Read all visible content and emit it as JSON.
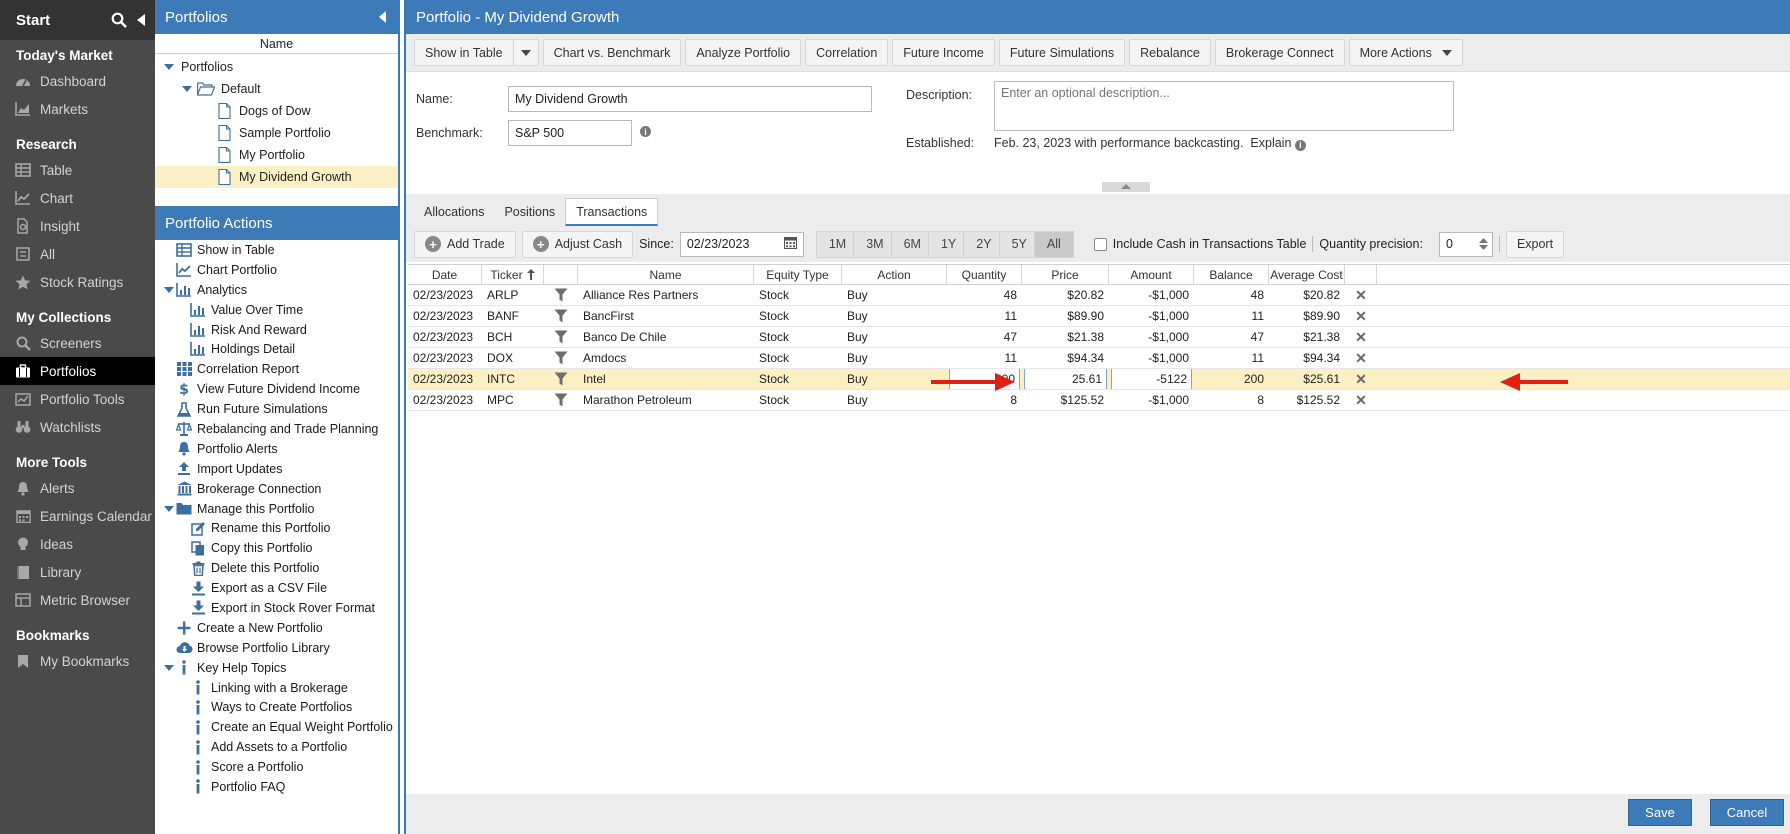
{
  "nav": {
    "start_label": "Start",
    "sections": [
      {
        "title": "Today's Market",
        "items": [
          {
            "label": "Dashboard",
            "icon": "dashboard-icon"
          },
          {
            "label": "Markets",
            "icon": "markets-icon"
          }
        ]
      },
      {
        "title": "Research",
        "items": [
          {
            "label": "Table",
            "icon": "table-icon"
          },
          {
            "label": "Chart",
            "icon": "chart-icon"
          },
          {
            "label": "Insight",
            "icon": "insight-icon"
          },
          {
            "label": "All",
            "icon": "all-icon"
          },
          {
            "label": "Stock Ratings",
            "icon": "star-icon"
          }
        ]
      },
      {
        "title": "My Collections",
        "items": [
          {
            "label": "Screeners",
            "icon": "search-icon"
          },
          {
            "label": "Portfolios",
            "icon": "briefcase-icon",
            "active": true
          },
          {
            "label": "Portfolio Tools",
            "icon": "tools-icon"
          },
          {
            "label": "Watchlists",
            "icon": "binoculars-icon"
          }
        ]
      },
      {
        "title": "More Tools",
        "items": [
          {
            "label": "Alerts",
            "icon": "bell-icon"
          },
          {
            "label": "Earnings Calendar",
            "icon": "calendar-icon"
          },
          {
            "label": "Ideas",
            "icon": "lightbulb-icon"
          },
          {
            "label": "Library",
            "icon": "library-icon"
          },
          {
            "label": "Metric Browser",
            "icon": "metric-browser-icon"
          }
        ]
      },
      {
        "title": "Bookmarks",
        "items": [
          {
            "label": "My Bookmarks",
            "icon": "bookmark-icon"
          }
        ]
      }
    ]
  },
  "tree": {
    "title": "Portfolios",
    "column_header": "Name",
    "nodes": [
      {
        "label": "Portfolios",
        "level": 0
      },
      {
        "label": "Default",
        "level": 1
      },
      {
        "label": "Dogs of Dow",
        "level": 2
      },
      {
        "label": "Sample Portfolio",
        "level": 2
      },
      {
        "label": "My Portfolio",
        "level": 2
      },
      {
        "label": "My Dividend Growth",
        "level": 2
      }
    ]
  },
  "portfolio_actions": {
    "title": "Portfolio Actions",
    "items": [
      {
        "label": "Show in Table",
        "level": 1,
        "icon": "table-icon"
      },
      {
        "label": "Chart Portfolio",
        "level": 1,
        "icon": "chart-icon"
      },
      {
        "label": "Analytics",
        "level": 0,
        "icon": "analytics-icon"
      },
      {
        "label": "Value Over Time",
        "level": 2,
        "icon": "bar-chart-icon"
      },
      {
        "label": "Risk And Reward",
        "level": 2,
        "icon": "bar-chart-icon"
      },
      {
        "label": "Holdings Detail",
        "level": 2,
        "icon": "bar-chart-icon"
      },
      {
        "label": "Correlation Report",
        "level": 1,
        "icon": "grid-icon"
      },
      {
        "label": "View Future Dividend Income",
        "level": 1,
        "icon": "dollar-icon"
      },
      {
        "label": "Run Future Simulations",
        "level": 1,
        "icon": "flask-icon"
      },
      {
        "label": "Rebalancing and Trade Planning",
        "level": 1,
        "icon": "scale-icon"
      },
      {
        "label": "Portfolio Alerts",
        "level": 1,
        "icon": "bell-icon"
      },
      {
        "label": "Import Updates",
        "level": 1,
        "icon": "upload-icon"
      },
      {
        "label": "Brokerage Connection",
        "level": 1,
        "icon": "bank-icon"
      },
      {
        "label": "Manage this Portfolio",
        "level": 0,
        "icon": "folder-icon"
      },
      {
        "label": "Rename this Portfolio",
        "level": 2,
        "icon": "edit-icon"
      },
      {
        "label": "Copy this Portfolio",
        "level": 2,
        "icon": "copy-icon"
      },
      {
        "label": "Delete this Portfolio",
        "level": 2,
        "icon": "trash-icon"
      },
      {
        "label": "Export as a CSV File",
        "level": 2,
        "icon": "download-icon"
      },
      {
        "label": "Export in Stock Rover Format",
        "level": 2,
        "icon": "download-icon"
      },
      {
        "label": "Create a New Portfolio",
        "level": 1,
        "icon": "plus-icon"
      },
      {
        "label": "Browse Portfolio Library",
        "level": 1,
        "icon": "cloud-download-icon"
      },
      {
        "label": "Key Help Topics",
        "level": 0,
        "icon": "info-icon"
      },
      {
        "label": "Linking with a Brokerage",
        "level": 2,
        "icon": "info-icon"
      },
      {
        "label": "Ways to Create Portfolios",
        "level": 2,
        "icon": "info-icon"
      },
      {
        "label": "Create an Equal Weight Portfolio",
        "level": 2,
        "icon": "info-icon"
      },
      {
        "label": "Add Assets to a Portfolio",
        "level": 2,
        "icon": "info-icon"
      },
      {
        "label": "Score a Portfolio",
        "level": 2,
        "icon": "info-icon"
      },
      {
        "label": "Portfolio FAQ",
        "level": 2,
        "icon": "info-icon"
      }
    ]
  },
  "main": {
    "title": "Portfolio - My Dividend Growth",
    "toolbar": [
      {
        "label": "Show in Table",
        "split": true
      },
      {
        "label": "Chart vs. Benchmark"
      },
      {
        "label": "Analyze Portfolio"
      },
      {
        "label": "Correlation"
      },
      {
        "label": "Future Income"
      },
      {
        "label": "Future Simulations"
      },
      {
        "label": "Rebalance"
      },
      {
        "label": "Brokerage Connect"
      },
      {
        "label": "More Actions",
        "dropdown": true
      }
    ],
    "form": {
      "name_label": "Name:",
      "name_value": "My Dividend Growth",
      "benchmark_label": "Benchmark:",
      "benchmark_value": "S&P 500",
      "description_label": "Description:",
      "description_placeholder": "Enter an optional description...",
      "established_label": "Established:",
      "established_value": "Feb. 23, 2023 with performance backcasting.",
      "explain_label": "Explain"
    },
    "tabs": [
      {
        "label": "Allocations"
      },
      {
        "label": "Positions"
      },
      {
        "label": "Transactions",
        "active": true
      }
    ],
    "tx_toolbar": {
      "add_trade": "Add Trade",
      "adjust_cash": "Adjust Cash",
      "since_label": "Since:",
      "since_value": "02/23/2023",
      "ranges": [
        "1M",
        "3M",
        "6M",
        "1Y",
        "2Y",
        "5Y",
        "All"
      ],
      "active_range": "All",
      "include_cash_label": "Include Cash in Transactions Table",
      "precision_label": "Quantity precision:",
      "precision_value": "0",
      "export_label": "Export"
    },
    "grid": {
      "columns": [
        "Date",
        "Ticker",
        "",
        "Name",
        "Equity Type",
        "Action",
        "Quantity",
        "Price",
        "Amount",
        "Balance",
        "Average Cost",
        ""
      ],
      "rows": [
        {
          "date": "02/23/2023",
          "ticker": "ARLP",
          "name": "Alliance Res Partners",
          "type": "Stock",
          "action": "Buy",
          "quantity": "48",
          "price": "$20.82",
          "amount": "-$1,000",
          "balance": "48",
          "avg_cost": "$20.82"
        },
        {
          "date": "02/23/2023",
          "ticker": "BANF",
          "name": "BancFirst",
          "type": "Stock",
          "action": "Buy",
          "quantity": "11",
          "price": "$89.90",
          "amount": "-$1,000",
          "balance": "11",
          "avg_cost": "$89.90"
        },
        {
          "date": "02/23/2023",
          "ticker": "BCH",
          "name": "Banco De Chile",
          "type": "Stock",
          "action": "Buy",
          "quantity": "47",
          "price": "$21.38",
          "amount": "-$1,000",
          "balance": "47",
          "avg_cost": "$21.38"
        },
        {
          "date": "02/23/2023",
          "ticker": "DOX",
          "name": "Amdocs",
          "type": "Stock",
          "action": "Buy",
          "quantity": "11",
          "price": "$94.34",
          "amount": "-$1,000",
          "balance": "11",
          "avg_cost": "$94.34"
        },
        {
          "date": "02/23/2023",
          "ticker": "INTC",
          "name": "Intel",
          "type": "Stock",
          "action": "Buy",
          "quantity": "200",
          "price": "25.61",
          "amount": "-5122",
          "balance": "200",
          "avg_cost": "$25.61",
          "editing": true
        },
        {
          "date": "02/23/2023",
          "ticker": "MPC",
          "name": "Marathon Petroleum",
          "type": "Stock",
          "action": "Buy",
          "quantity": "8",
          "price": "$125.52",
          "amount": "-$1,000",
          "balance": "8",
          "avg_cost": "$125.52"
        }
      ]
    },
    "footer": {
      "save": "Save",
      "cancel": "Cancel"
    },
    "colors": {
      "accent": "#3d7ab8",
      "highlight": "#fbf0c4",
      "annotation_arrow": "#e02010"
    }
  }
}
